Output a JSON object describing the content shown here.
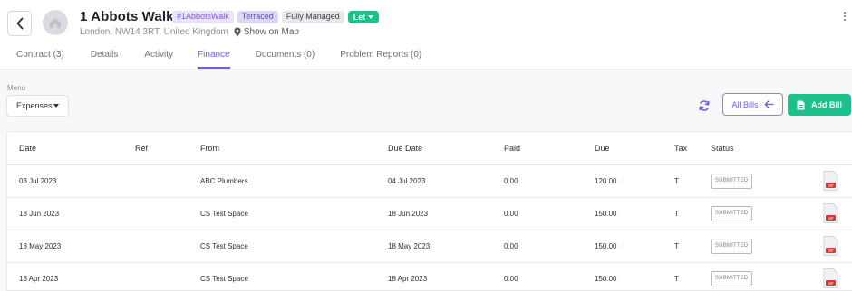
{
  "header": {
    "title": "1 Abbots Walk",
    "badges": {
      "tag": "#1AbbotsWalk",
      "type": "Terraced",
      "management": "Fully Managed",
      "status": "Let"
    },
    "address": "London, NW14 3RT, United Kingdom",
    "map_link": "Show on Map"
  },
  "tabs": [
    "Contract (3)",
    "Details",
    "Activity",
    "Finance",
    "Documents (0)",
    "Problem Reports (0)"
  ],
  "active_tab": "Finance",
  "toolbar": {
    "menu_label": "Menu",
    "menu_value": "Expenses",
    "all_bills_label": "All Bills",
    "add_bill_label": "Add Bill"
  },
  "table": {
    "columns": [
      "Date",
      "Ref",
      "From",
      "Due Date",
      "Paid",
      "Due",
      "Tax",
      "Status"
    ],
    "rows": [
      {
        "date": "03 Jul 2023",
        "ref": "",
        "from": "ABC Plumbers",
        "due_date": "04 Jul 2023",
        "paid": "0.00",
        "due": "120.00",
        "tax": "T",
        "status": "SUBMITTED"
      },
      {
        "date": "18 Jun 2023",
        "ref": "",
        "from": "CS Test Space",
        "due_date": "18 Jun 2023",
        "paid": "0.00",
        "due": "150.00",
        "tax": "T",
        "status": "SUBMITTED"
      },
      {
        "date": "18 May 2023",
        "ref": "",
        "from": "CS Test Space",
        "due_date": "18 May 2023",
        "paid": "0.00",
        "due": "150.00",
        "tax": "T",
        "status": "SUBMITTED"
      },
      {
        "date": "18 Apr 2023",
        "ref": "",
        "from": "CS Test Space",
        "due_date": "18 Apr 2023",
        "paid": "0.00",
        "due": "150.00",
        "tax": "T",
        "status": "SUBMITTED"
      }
    ]
  },
  "icons": {
    "back": "chevron-left-icon",
    "avatar": "house-icon",
    "map": "map-pin-icon",
    "more": "more-vertical-icon",
    "refresh": "refresh-icon",
    "all_bills": "arrow-left-icon",
    "add_bill": "document-icon",
    "row_file": "pdf-icon"
  },
  "colors": {
    "accent": "#6e5fd6",
    "success": "#1dbf8a",
    "tag_bg": "#e9e3fb",
    "content_bg": "#f7f8fa"
  }
}
